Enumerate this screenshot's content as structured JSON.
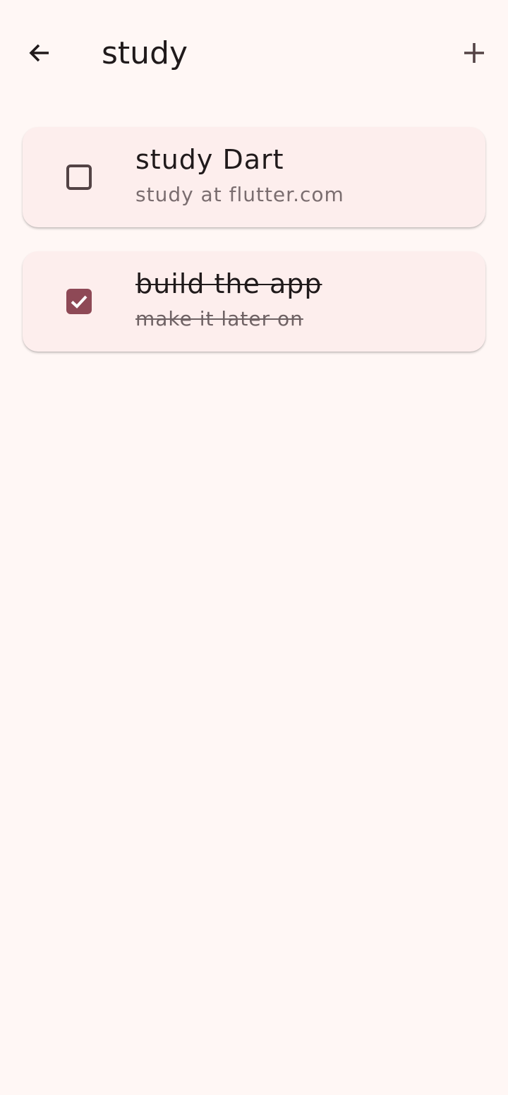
{
  "app_bar": {
    "title": "study",
    "back_icon": "arrow-left-icon",
    "add_icon": "plus-icon"
  },
  "tasks": [
    {
      "title": "study Dart",
      "subtitle": "study at flutter.com",
      "done": false
    },
    {
      "title": "build the app",
      "subtitle": "make it later on",
      "done": true
    }
  ],
  "colors": {
    "background": "#fff7f5",
    "card": "#fdeeed",
    "accent": "#8e4956"
  }
}
